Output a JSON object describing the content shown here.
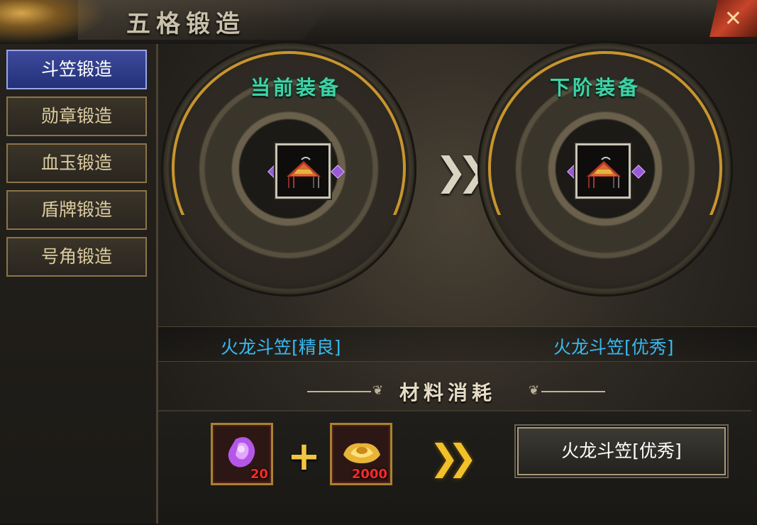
{
  "window": {
    "title": "五格锻造",
    "close_icon": "close-x-icon"
  },
  "sidebar": {
    "items": [
      {
        "label": "斗笠锻造",
        "active": true
      },
      {
        "label": "勋章锻造",
        "active": false
      },
      {
        "label": "血玉锻造",
        "active": false
      },
      {
        "label": "盾牌锻造",
        "active": false
      },
      {
        "label": "号角锻造",
        "active": false
      }
    ]
  },
  "forge": {
    "current": {
      "heading": "当前装备",
      "item_name": "火龙斗笠[精良]",
      "icon": "dragon-hat-icon"
    },
    "next": {
      "heading": "下阶装备",
      "item_name": "火龙斗笠[优秀]",
      "icon": "dragon-hat-icon"
    },
    "transition_icon": "double-chevron-right-icon"
  },
  "materials": {
    "heading": "材料消耗",
    "items": [
      {
        "icon": "purple-crystal-icon",
        "count": "20"
      },
      {
        "icon": "gold-ingot-icon",
        "count": "2000"
      }
    ],
    "plus_symbol": "+",
    "result_button_label": "火龙斗笠[优秀]"
  },
  "colors": {
    "section_heading": "#3fd3a6",
    "item_name": "#38b9f0",
    "active_tab": "#2e3a8a",
    "count_text": "#ff2a2a",
    "gold_accent": "#c8952e"
  }
}
